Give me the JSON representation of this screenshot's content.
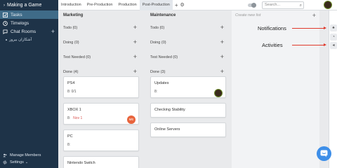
{
  "sidebar": {
    "project_title": "Making a Game",
    "items": [
      {
        "label": "Tasks",
        "icon": "checkbox-icon",
        "active": true
      },
      {
        "label": "Timelogs",
        "icon": "clock-icon",
        "active": false
      },
      {
        "label": "Chat Rooms",
        "icon": "chat-icon",
        "active": false
      }
    ],
    "chat_room": "آشکاران بیروز",
    "bottom": [
      {
        "label": "Manage Members",
        "icon": "people-icon"
      },
      {
        "label": "Settings",
        "icon": "gear-icon"
      }
    ]
  },
  "topbar": {
    "tabs": [
      "Introduction",
      "Pre-Production",
      "Production",
      "Post-Production"
    ],
    "active_tab": "Post-Production",
    "search_placeholder": "Search..."
  },
  "columns": [
    {
      "title": "Marketing",
      "statuses": [
        {
          "label": "Todo",
          "count": "(0)"
        },
        {
          "label": "Doing",
          "count": "(0)"
        },
        {
          "label": "Test Needed",
          "count": "(0)"
        },
        {
          "label": "Done",
          "count": "(4)"
        }
      ],
      "cards": [
        {
          "title": "PS4",
          "meta": "8:",
          "extra": "0/1"
        },
        {
          "title": "XBOX 1",
          "meta": "8:",
          "extra": "Nov 1",
          "avatar_initials": "ME"
        },
        {
          "title": "PC",
          "meta": "8:",
          "extra": ""
        },
        {
          "title": "Nintendo Switch",
          "meta": "",
          "extra": ""
        }
      ]
    },
    {
      "title": "Maintenance",
      "statuses": [
        {
          "label": "Todo",
          "count": "(0)"
        },
        {
          "label": "Doing",
          "count": "(0)"
        },
        {
          "label": "Test Needed",
          "count": "(0)"
        },
        {
          "label": "Done",
          "count": "(3)"
        }
      ],
      "cards": [
        {
          "title": "Updates",
          "meta": "8:",
          "extra": ""
        },
        {
          "title": "Checking Stability",
          "meta": "",
          "extra": ""
        },
        {
          "title": "Online Servers",
          "meta": "",
          "extra": ""
        }
      ]
    }
  ],
  "new_list_placeholder": "Create new list",
  "annotations": {
    "notifications": "Notifications",
    "activities": "Activities"
  },
  "colors": {
    "sidebar": "#1e3348",
    "active_item": "#3f6b88",
    "accent": "#3d8ee8",
    "arrow": "#e03a2c"
  }
}
